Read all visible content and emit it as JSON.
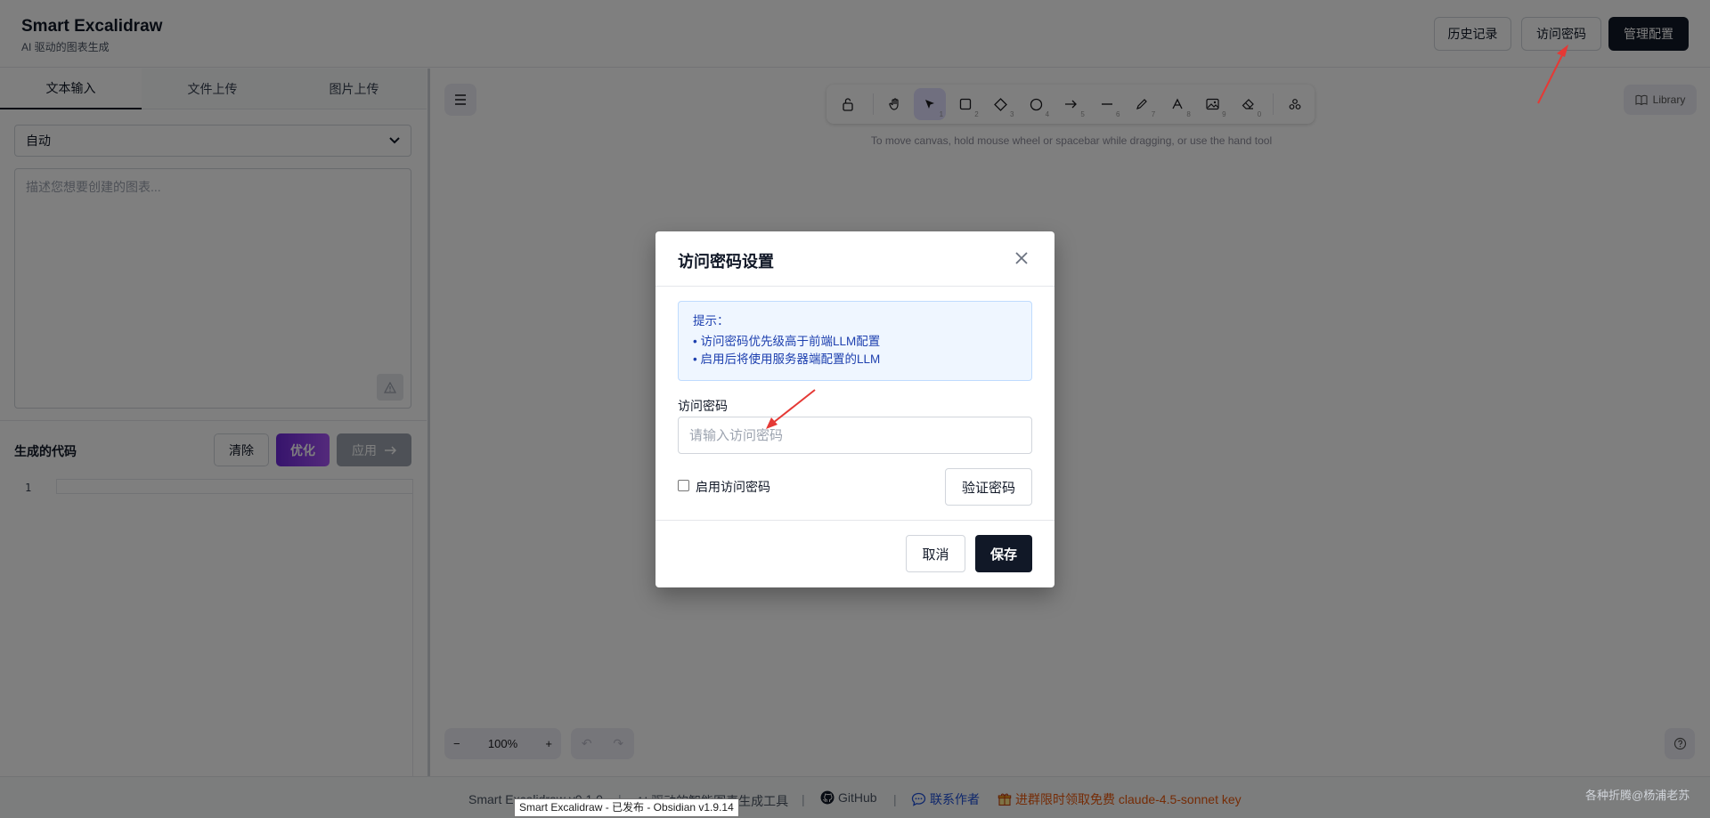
{
  "header": {
    "title": "Smart Excalidraw",
    "subtitle": "AI 驱动的图表生成",
    "buttons": {
      "history": "历史记录",
      "access_password": "访问密码",
      "manage_config": "管理配置"
    }
  },
  "left_panel": {
    "tabs": [
      "文本输入",
      "文件上传",
      "图片上传"
    ],
    "mode_select": {
      "value": "自动"
    },
    "prompt": {
      "placeholder": "描述您想要创建的图表..."
    },
    "code_section": {
      "title": "生成的代码",
      "clear": "清除",
      "optimize": "优化",
      "apply": "应用"
    },
    "editor": {
      "line_number": "1"
    }
  },
  "canvas": {
    "toolbar_hint": "To move canvas, hold mouse wheel or spacebar while dragging, or use the hand tool",
    "tools": [
      {
        "icon": "lock-icon",
        "key": ""
      },
      {
        "icon": "hand-icon",
        "key": ""
      },
      {
        "icon": "selection-icon",
        "key": "1"
      },
      {
        "icon": "rectangle-icon",
        "key": "2"
      },
      {
        "icon": "diamond-icon",
        "key": "3"
      },
      {
        "icon": "ellipse-icon",
        "key": "4"
      },
      {
        "icon": "arrow-icon",
        "key": "5"
      },
      {
        "icon": "line-icon",
        "key": "6"
      },
      {
        "icon": "pencil-icon",
        "key": "7"
      },
      {
        "icon": "text-icon",
        "key": "8"
      },
      {
        "icon": "image-icon",
        "key": "9"
      },
      {
        "icon": "eraser-icon",
        "key": "0"
      },
      {
        "icon": "shapes-icon",
        "key": ""
      }
    ],
    "library_label": "Library",
    "zoom_level": "100%"
  },
  "dialog": {
    "title": "访问密码设置",
    "info": {
      "heading": "提示：",
      "lines": [
        "• 访问密码优先级高于前端LLM配置",
        "• 启用后将使用服务器端配置的LLM"
      ]
    },
    "password_label": "访问密码",
    "password_placeholder": "请输入访问密码",
    "enable_label": "启用访问密码",
    "enable_checked": false,
    "verify": "验证密码",
    "cancel": "取消",
    "save": "保存"
  },
  "footer": {
    "version": "Smart Excalidraw v0.1.0",
    "sep": "|",
    "tagline": "AI 驱动的智能图表生成工具",
    "github": "GitHub",
    "contact": "联系作者",
    "promo": "进群限时领取免费 claude-4.5-sonnet key"
  },
  "tooltip": "Smart Excalidraw - 已发布 - Obsidian v1.9.14",
  "watermark": "各种折腾@杨浦老苏",
  "colors": {
    "primary_dark": "#111827",
    "optimize_gradient": [
      "#6d28d9",
      "#a855f7"
    ],
    "info_blue": "#1e40af",
    "promo_orange": "#ea580c",
    "annotation_red": "#e53935"
  }
}
